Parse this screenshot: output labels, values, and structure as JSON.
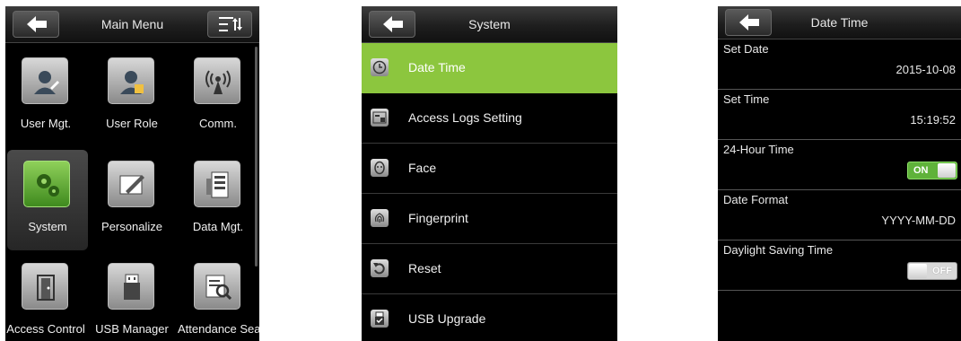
{
  "main_menu": {
    "title": "Main Menu",
    "items": [
      {
        "label": "User Mgt.",
        "icon": "user-mgt-icon"
      },
      {
        "label": "User Role",
        "icon": "user-role-icon"
      },
      {
        "label": "Comm.",
        "icon": "comm-icon"
      },
      {
        "label": "System",
        "icon": "system-icon",
        "selected": true
      },
      {
        "label": "Personalize",
        "icon": "personalize-icon"
      },
      {
        "label": "Data Mgt.",
        "icon": "data-mgt-icon"
      },
      {
        "label": "Access Control",
        "icon": "access-control-icon"
      },
      {
        "label": "USB Manager",
        "icon": "usb-manager-icon"
      },
      {
        "label": "Attendance Search",
        "icon": "attendance-search-icon"
      }
    ]
  },
  "system": {
    "title": "System",
    "items": [
      {
        "label": "Date Time",
        "icon": "clock-icon",
        "active": true
      },
      {
        "label": "Access Logs Setting",
        "icon": "access-logs-icon"
      },
      {
        "label": "Face",
        "icon": "face-icon"
      },
      {
        "label": "Fingerprint",
        "icon": "fingerprint-icon"
      },
      {
        "label": "Reset",
        "icon": "reset-icon"
      },
      {
        "label": "USB Upgrade",
        "icon": "usb-upgrade-icon"
      }
    ]
  },
  "date_time": {
    "title": "Date Time",
    "set_date_label": "Set Date",
    "set_date_value": "2015-10-08",
    "set_time_label": "Set Time",
    "set_time_value": "15:19:52",
    "hour24_label": "24-Hour Time",
    "hour24_state": "ON",
    "date_format_label": "Date Format",
    "date_format_value": "YYYY-MM-DD",
    "dst_label": "Daylight Saving Time",
    "dst_state": "OFF"
  },
  "colors": {
    "accent_green": "#8cc63e",
    "screen_bg": "#000000"
  }
}
